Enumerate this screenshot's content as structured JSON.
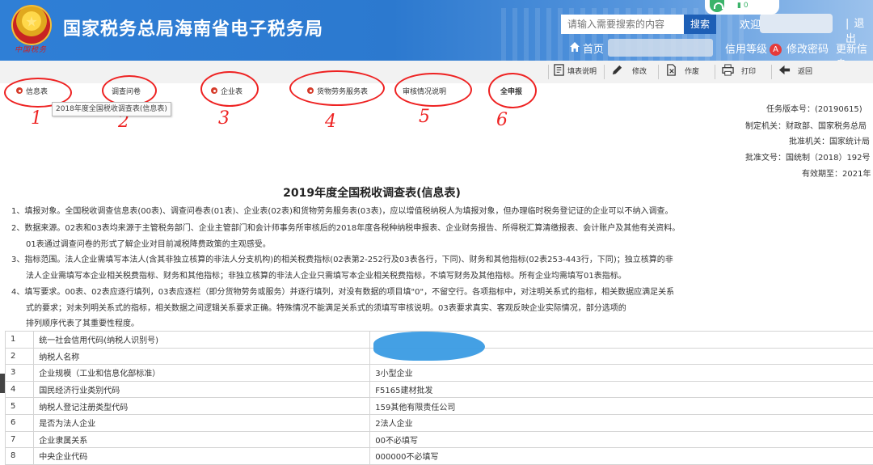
{
  "header": {
    "site_title": "国家税务总局海南省电子税务局",
    "seal_text": "中国税务",
    "search_placeholder": "请输入需要搜索的内容",
    "search_button": "搜索",
    "welcome": "欢迎,",
    "logout": "退出",
    "battery": "0",
    "nav": {
      "home": "首页",
      "credit_level": "信用等级",
      "credit_badge": "A",
      "change_password": "修改密码",
      "update_info": "更新信息"
    }
  },
  "toolbar": {
    "fill_instructions": "填表说明",
    "edit": "修改",
    "void": "作废",
    "print": "打印",
    "back": "返回"
  },
  "tabs": [
    {
      "label": "信息表",
      "mark": "1"
    },
    {
      "label": "调查问卷",
      "mark": "2"
    },
    {
      "label": "企业表",
      "mark": "3"
    },
    {
      "label": "货物劳务服务表",
      "mark": "4"
    },
    {
      "label": "审核情况说明",
      "mark": "5"
    },
    {
      "label": "全申报",
      "mark": "6"
    }
  ],
  "tooltip": "2018年度全国税收调查表(信息表)",
  "meta": {
    "version": "任务版本号：(20190615)",
    "issuer": "制定机关：财政部、国家税务总局",
    "approver": "批准机关：国家统计局",
    "approval_no": "批准文号：国统制（2018）192号",
    "valid_until": "有效期至：2021年"
  },
  "form_title": "2019年度全国税收调查表(信息表)",
  "instructions": [
    "1、填报对象。全国税收调查信息表(00表)、调查问卷表(01表)、企业表(02表)和货物劳务服务表(03表)，应以增值税纳税人为填报对象，但办理临时税务登记证的企业可以不纳入调查。",
    "2、数据来源。02表和03表均来源于主管税务部门、企业主管部门和会计师事务所审核后的2018年度各税种纳税申报表、企业财务报告、所得税汇算清缴报表、会计账户及其他有关资料。",
    "01表通过调查问卷的形式了解企业对目前减税降费政策的主观感受。",
    "3、指标范围。法人企业需填写本法人(含其非独立核算的非法人分支机构)的相关税费指标(02表第2-252行及03表各行，下同)、财务和其他指标(02表253-443行，下同)；独立核算的非",
    "法人企业需填写本企业相关税费指标、财务和其他指标；非独立核算的非法人企业只需填写本企业相关税费指标，不填写财务及其他指标。所有企业均需填写01表指标。",
    "4、填写要求。00表、02表应逐行填列，03表应逐栏（即分货物劳务或服务）并逐行填列，对没有数据的项目填\"0\"，不留空行。各项指标中，对注明关系式的指标，相关数据应满足关系",
    "式的要求；对未列明关系式的指标，相关数据之间逻辑关系要求正确。特殊情况不能满足关系式的须填写审核说明。03表要求真实、客观反映企业实际情况，部分选项的",
    "排列顺序代表了其重要性程度。"
  ],
  "rows": [
    {
      "no": "1",
      "name": "统一社会信用代码(纳税人识别号)",
      "value": ""
    },
    {
      "no": "2",
      "name": "纳税人名称",
      "value": ""
    },
    {
      "no": "3",
      "name": "企业规模（工业和信息化部标准）",
      "value": "3小型企业"
    },
    {
      "no": "4",
      "name": "国民经济行业类别代码",
      "value": "F5165建材批发"
    },
    {
      "no": "5",
      "name": "纳税人登记注册类型代码",
      "value": "159其他有限责任公司"
    },
    {
      "no": "6",
      "name": "是否为法人企业",
      "value": "2法人企业"
    },
    {
      "no": "7",
      "name": "企业隶属关系",
      "value": "00不必填写"
    },
    {
      "no": "8",
      "name": "中央企业代码",
      "value": "000000不必填写"
    }
  ]
}
